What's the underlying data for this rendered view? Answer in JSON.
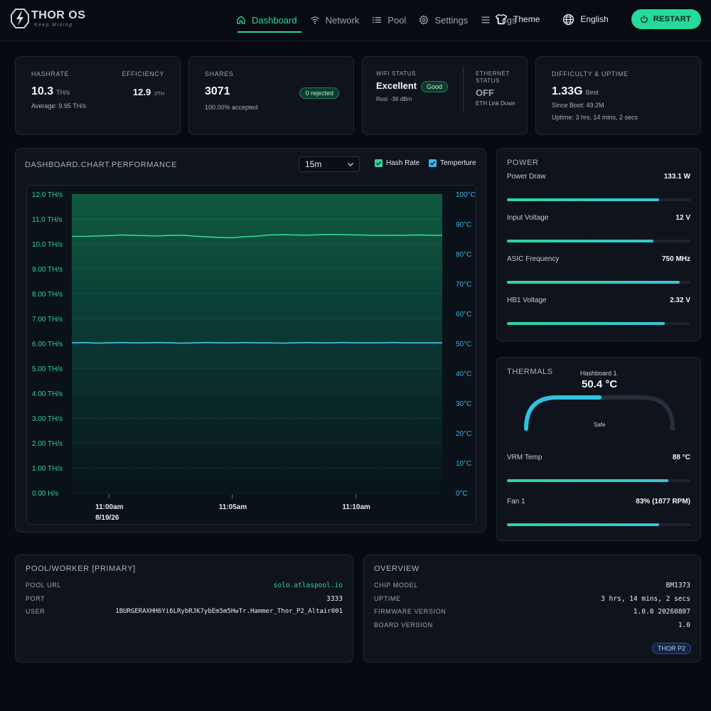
{
  "brand": {
    "name": "THOR OS",
    "tagline": "Keep Mining"
  },
  "nav": [
    {
      "label": "Dashboard",
      "icon": "home-icon",
      "active": true
    },
    {
      "label": "Network",
      "icon": "wifi-icon"
    },
    {
      "label": "Pool",
      "icon": "list-icon"
    },
    {
      "label": "Settings",
      "icon": "gear-icon"
    },
    {
      "label": "Logs",
      "icon": "logs-icon"
    }
  ],
  "controls": {
    "theme": "Theme",
    "language": "English",
    "restart": "RESTART"
  },
  "stats": {
    "hashrate": {
      "label": "HASHRATE",
      "value": "10.3",
      "unit": "TH/s",
      "average": "Average: 9.95 TH/s"
    },
    "efficiency": {
      "label": "EFFICIENCY",
      "value": "12.9",
      "unit": "J/TH"
    },
    "shares": {
      "label": "SHARES",
      "value": "3071",
      "badge": "0 rejected",
      "accepted": "100.00% accepted"
    },
    "wifi": {
      "label": "WIFI STATUS",
      "value": "Excellent",
      "badge": "Good",
      "rssi": "Rssi: -36 dBm"
    },
    "ethernet": {
      "label_line1": "ETHERNET",
      "label_line2": "STATUS",
      "value": "OFF",
      "detail": "ETH Link Down"
    },
    "difficulty": {
      "label": "DIFFICULTY & UPTIME",
      "value": "1.33G",
      "best": "Best",
      "since_boot": "Since Boot: 49.2M",
      "uptime": "Uptime: 3 hrs, 14 mins, 2 secs"
    }
  },
  "chart_panel": {
    "title": "DASHBOARD.CHART.PERFORMANCE",
    "range": "15m",
    "legend": {
      "hash_rate": "Hash Rate",
      "temperature": "Temperture"
    }
  },
  "chart_data": {
    "type": "line",
    "x_tick_labels": [
      "11:00am",
      "11:05am",
      "11:10am"
    ],
    "x_date_label": "8/19/26",
    "y_left_ticks": [
      "0.00 H/s",
      "1.00 TH/s",
      "2.00 TH/s",
      "3.00 TH/s",
      "4.00 TH/s",
      "5.00 TH/s",
      "6.00 TH/s",
      "7.00 TH/s",
      "8.00 TH/s",
      "9.00 TH/s",
      "10.0 TH/s",
      "11.0 TH/s",
      "12.0 TH/s"
    ],
    "y_right_ticks": [
      "0°C",
      "10°C",
      "20°C",
      "30°C",
      "40°C",
      "50°C",
      "60°C",
      "70°C",
      "80°C",
      "90°C",
      "100°C"
    ],
    "ylim_left": [
      0,
      12
    ],
    "ylim_right": [
      0,
      100
    ],
    "x": [
      "10:58:30",
      "10:59:00",
      "10:59:30",
      "11:00:00",
      "11:00:30",
      "11:01:00",
      "11:01:30",
      "11:02:00",
      "11:02:30",
      "11:03:00",
      "11:03:30",
      "11:04:00",
      "11:04:30",
      "11:05:00",
      "11:05:30",
      "11:06:00",
      "11:06:30",
      "11:07:00",
      "11:07:30",
      "11:08:00",
      "11:08:30",
      "11:09:00",
      "11:09:30",
      "11:10:00",
      "11:10:30",
      "11:11:00",
      "11:11:30",
      "11:12:00",
      "11:12:30",
      "11:13:00",
      "11:13:30"
    ],
    "series": [
      {
        "name": "Hash Rate",
        "color": "#2fd59a",
        "axis": "left",
        "values": [
          10.3,
          10.3,
          10.32,
          10.33,
          10.36,
          10.34,
          10.33,
          10.32,
          10.34,
          10.35,
          10.31,
          10.28,
          10.26,
          10.25,
          10.29,
          10.31,
          10.36,
          10.37,
          10.36,
          10.35,
          10.37,
          10.38,
          10.37,
          10.36,
          10.35,
          10.35,
          10.34,
          10.35,
          10.36,
          10.35,
          10.35
        ]
      },
      {
        "name": "Temperture",
        "color": "#3cc4e6",
        "axis": "right",
        "values": [
          50.2,
          50.3,
          50.1,
          50.2,
          50.3,
          50.2,
          50.2,
          50.3,
          50.2,
          50.1,
          50.2,
          50.3,
          50.2,
          50.2,
          50.3,
          50.2,
          50.2,
          50.1,
          50.2,
          50.3,
          50.2,
          50.2,
          50.3,
          50.2,
          50.2,
          50.2,
          50.3,
          50.2,
          50.2,
          50.2,
          50.2
        ]
      }
    ]
  },
  "power": {
    "title": "POWER",
    "items": [
      {
        "name": "Power Draw",
        "value": "133.1 W",
        "level": 0.83
      },
      {
        "name": "Input Voltage",
        "value": "12 V",
        "level": 0.8
      },
      {
        "name": "ASIC Frequency",
        "value": "750 MHz",
        "level": 0.94
      },
      {
        "name": "HB1 Voltage",
        "value": "2.32 V",
        "level": 0.86
      }
    ]
  },
  "thermals": {
    "title": "THERMALS",
    "gauge": {
      "label": "Hashboard 1",
      "value": "50.4 °C",
      "status": "Safe",
      "level": 0.5
    },
    "items": [
      {
        "name": "VRM Temp",
        "value": "88 °C",
        "level": 0.88
      },
      {
        "name": "Fan 1",
        "value": "83% (1877 RPM)",
        "level": 0.83
      }
    ]
  },
  "pool": {
    "title": "POOL/WORKER [PRIMARY]",
    "rows": [
      {
        "key": "POOL URL",
        "value": "solo.atlaspool.io"
      },
      {
        "key": "PORT",
        "value": "3333"
      },
      {
        "key": "USER",
        "value": "1BURGERAXHH6Yi6LRybRJK7ybEm5m5HwTr.Hammer_Thor_P2_Altair001"
      }
    ]
  },
  "overview": {
    "title": "OVERVIEW",
    "rows": [
      {
        "key": "CHIP MODEL",
        "value": "BM1373"
      },
      {
        "key": "UPTIME",
        "value": "3 hrs, 14 mins, 2 secs"
      },
      {
        "key": "FIRMWARE VERSION",
        "value": "1.0.0 20260807"
      },
      {
        "key": "BOARD VERSION",
        "value": "1.0"
      }
    ],
    "badge": "THOR P2"
  },
  "colors": {
    "accent": "#2fd59a",
    "temp": "#3cc4e6",
    "background": "#070b11",
    "card": "#0f141c"
  }
}
